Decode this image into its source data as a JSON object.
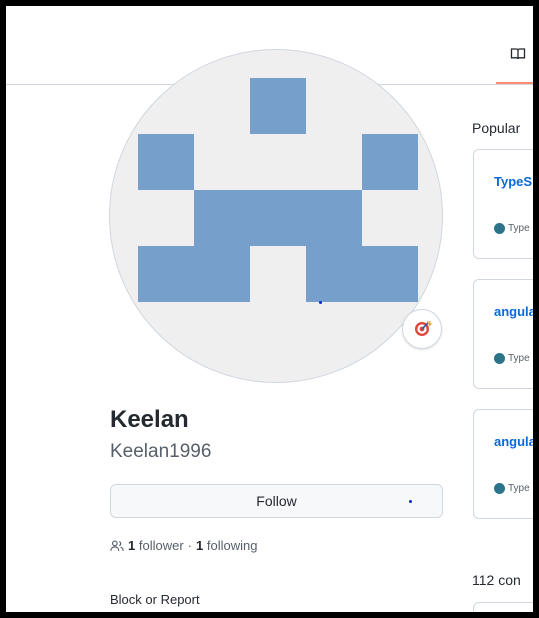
{
  "tabs": {
    "active_icon": "book-icon"
  },
  "profile": {
    "name": "Keelan",
    "login": "Keelan1996",
    "follow_label": "Follow",
    "followers_count": "1",
    "followers_label": "follower",
    "separator": "·",
    "following_count": "1",
    "following_label": "following",
    "block_report_label": "Block or Report",
    "status_emoji": "dart-icon"
  },
  "popular": {
    "title": "Popular",
    "repos": [
      {
        "name": "TypeS",
        "language": "Type"
      },
      {
        "name": "angula",
        "language": "Type"
      },
      {
        "name": "angula",
        "language": "Type"
      }
    ]
  },
  "contributions": {
    "summary": "112 con"
  },
  "colors": {
    "avatar_blue": "#779fcc",
    "link_blue": "#0969da",
    "typescript": "#2b7489",
    "tab_accent": "#fd8c73"
  }
}
